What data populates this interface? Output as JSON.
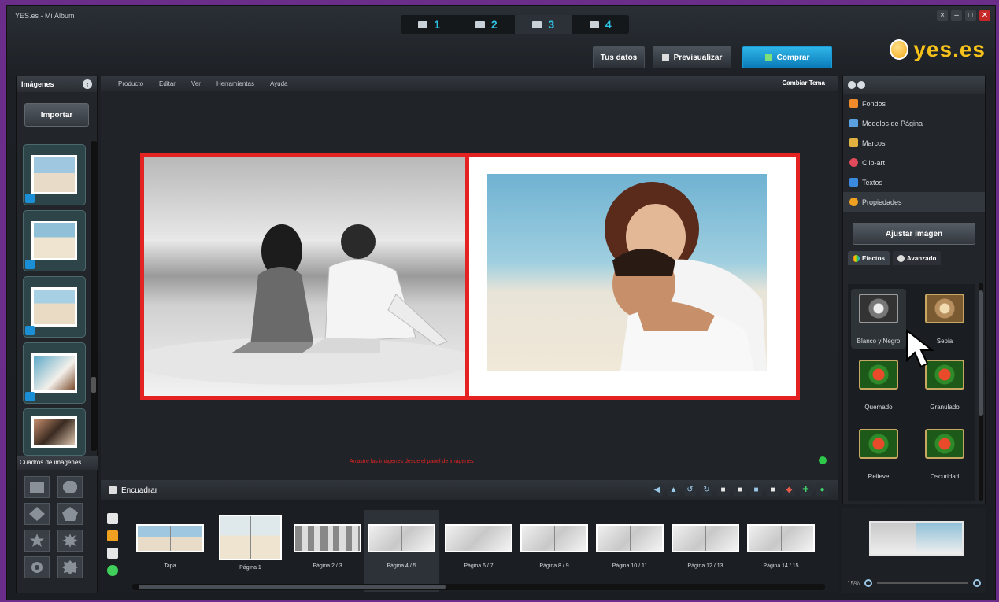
{
  "window": {
    "title": "YES.es - Mi Álbum",
    "controls": [
      "×",
      "–",
      "□",
      "✕"
    ]
  },
  "steps": [
    {
      "num": "1",
      "icon": "book-icon"
    },
    {
      "num": "2",
      "icon": "pencil-icon"
    },
    {
      "num": "3",
      "icon": "image-icon",
      "active": true
    },
    {
      "num": "4",
      "icon": "cart-icon"
    }
  ],
  "top_buttons": {
    "tus_datos": "Tus datos",
    "previsualizar": "Previsualizar",
    "comprar": "Comprar"
  },
  "logo": {
    "text": "yes.es"
  },
  "left_panel": {
    "header": "Imágenes",
    "import_label": "Importar",
    "shapes_header": "Cuadros de imágenes"
  },
  "menu": {
    "items": [
      "Producto",
      "Editar",
      "Ver",
      "Herramientas",
      "Ayuda"
    ],
    "theme": "Cambiar Tema"
  },
  "status_message": "Arrastre las imágenes desde el panel de imágenes",
  "frame_toolbar": {
    "label": "Encuadrar"
  },
  "pages": [
    {
      "label": "Tapa"
    },
    {
      "label": "Página 1"
    },
    {
      "label": "Página 2 / 3"
    },
    {
      "label": "Página 4 / 5",
      "selected": true
    },
    {
      "label": "Página 6 / 7"
    },
    {
      "label": "Página 8 / 9"
    },
    {
      "label": "Página 10 / 11"
    },
    {
      "label": "Página 12 / 13"
    },
    {
      "label": "Página 14 / 15"
    }
  ],
  "right_panel": {
    "items": [
      {
        "label": "Fondos",
        "color": "#f08a2a"
      },
      {
        "label": "Modelos de Página",
        "color": "#5aa0e0"
      },
      {
        "label": "Marcos",
        "color": "#e0b040"
      },
      {
        "label": "Clip-art",
        "color": "#e04a5a"
      },
      {
        "label": "Textos",
        "color": "#3a8ae0"
      },
      {
        "label": "Propiedades",
        "color": "#f0a020"
      }
    ],
    "adjust_label": "Ajustar imagen",
    "tabs": [
      "Efectos",
      "Avanzado"
    ],
    "effects": [
      "Blanco y Negro",
      "Sepia",
      "Quemado",
      "Granulado",
      "Relieve",
      "Oscuridad"
    ]
  },
  "zoom": {
    "level": "15%"
  },
  "colors": {
    "accent": "#1a9cd6",
    "selection": "#e52222",
    "logo": "#f6c21a"
  }
}
